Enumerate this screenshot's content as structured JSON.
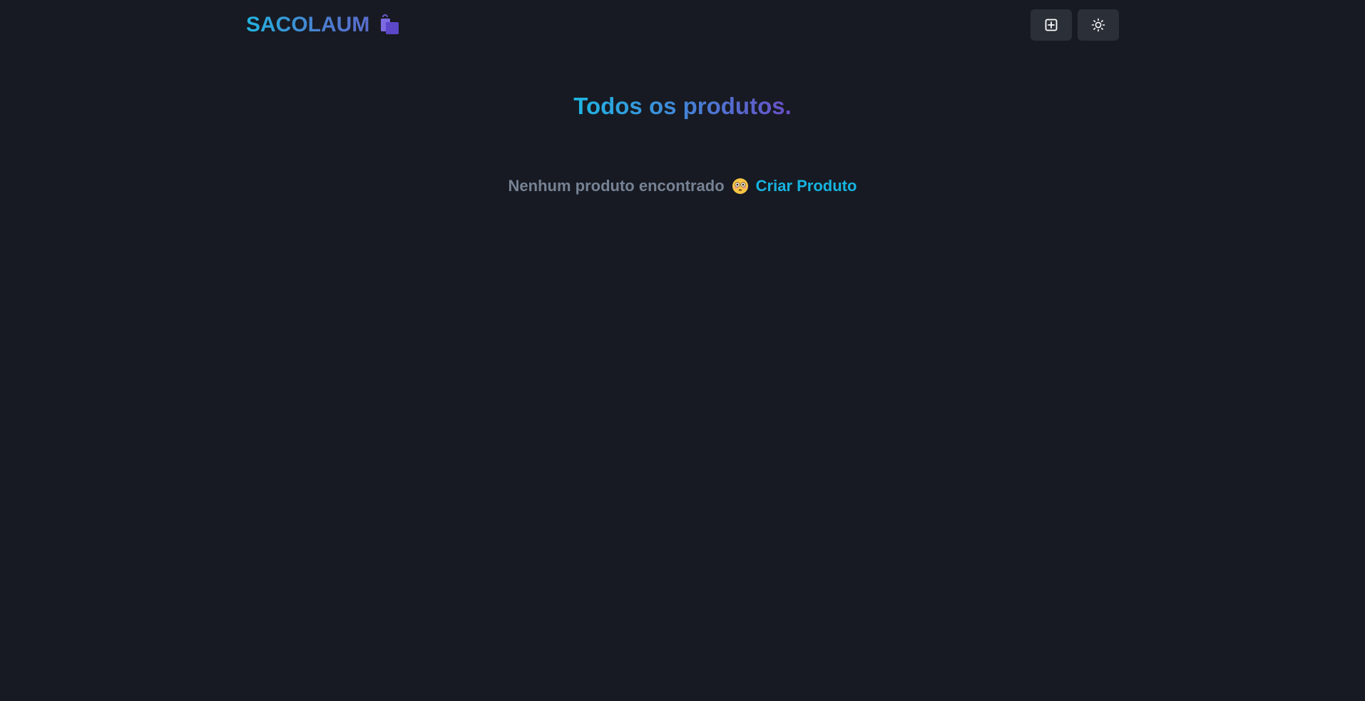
{
  "navbar": {
    "logo_text": "SACOLAUM",
    "logo_icon": "shopping-bags-icon",
    "create_button_icon": "plus-square-icon",
    "theme_button_icon": "sun-icon"
  },
  "main": {
    "title": "Todos os produtos.",
    "empty_message": "Nenhum produto encontrado",
    "empty_emoji": "flushed-face-icon",
    "create_link_label": "Criar Produto"
  },
  "colors": {
    "background": "#171a22",
    "button_bg": "#2b2f38",
    "accent_cyan": "#16b3df",
    "accent_purple": "#6a4ec7",
    "muted_text": "#768294"
  }
}
